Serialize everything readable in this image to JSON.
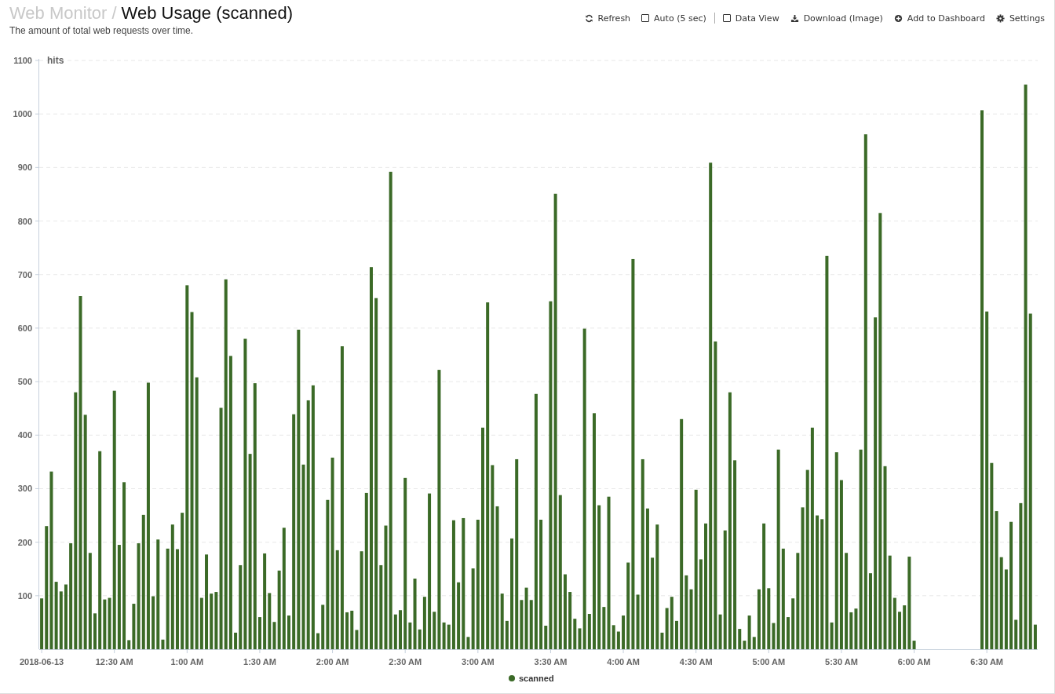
{
  "header": {
    "breadcrumb": "Web Monitor /",
    "title": "Web Usage (scanned)",
    "subtitle": "The amount of total web requests over time."
  },
  "toolbar": [
    {
      "kind": "refresh",
      "label": "Refresh"
    },
    {
      "kind": "checkbox",
      "label": "Auto (5 sec)",
      "checked": false
    },
    {
      "kind": "separator"
    },
    {
      "kind": "checkbox",
      "label": "Data View",
      "checked": false
    },
    {
      "kind": "download",
      "label": "Download (Image)"
    },
    {
      "kind": "add",
      "label": "Add to Dashboard"
    },
    {
      "kind": "settings",
      "label": "Settings"
    }
  ],
  "chart_data": {
    "type": "bar",
    "grid": true,
    "ylabel": "hits",
    "xlim": [
      -1,
      411
    ],
    "ylim": [
      0,
      1100
    ],
    "yticks": [
      100,
      200,
      300,
      400,
      500,
      600,
      700,
      800,
      900,
      1000,
      1100
    ],
    "xticks": [
      {
        "value": 0,
        "label": "2018-06-13"
      },
      {
        "value": 30,
        "label": "12:30 AM"
      },
      {
        "value": 60,
        "label": "1:00 AM"
      },
      {
        "value": 90,
        "label": "1:30 AM"
      },
      {
        "value": 120,
        "label": "2:00 AM"
      },
      {
        "value": 150,
        "label": "2:30 AM"
      },
      {
        "value": 180,
        "label": "3:00 AM"
      },
      {
        "value": 210,
        "label": "3:30 AM"
      },
      {
        "value": 240,
        "label": "4:00 AM"
      },
      {
        "value": 270,
        "label": "4:30 AM"
      },
      {
        "value": 300,
        "label": "5:00 AM"
      },
      {
        "value": 330,
        "label": "5:30 AM"
      },
      {
        "value": 360,
        "label": "6:00 AM"
      },
      {
        "value": 390,
        "label": "6:30 AM"
      }
    ],
    "x": [
      0,
      2,
      4,
      6,
      8,
      10,
      12,
      14,
      16,
      18,
      20,
      22,
      24,
      26,
      28,
      30,
      32,
      34,
      36,
      38,
      40,
      42,
      44,
      46,
      48,
      50,
      52,
      54,
      56,
      58,
      60,
      62,
      64,
      66,
      68,
      70,
      72,
      74,
      76,
      78,
      80,
      82,
      84,
      86,
      88,
      90,
      92,
      94,
      96,
      98,
      100,
      102,
      104,
      106,
      108,
      110,
      112,
      114,
      116,
      118,
      120,
      122,
      124,
      126,
      128,
      130,
      132,
      134,
      136,
      138,
      140,
      142,
      144,
      146,
      148,
      150,
      152,
      154,
      156,
      158,
      160,
      162,
      164,
      166,
      168,
      170,
      172,
      174,
      176,
      178,
      180,
      182,
      184,
      186,
      188,
      190,
      192,
      194,
      196,
      198,
      200,
      202,
      204,
      206,
      208,
      210,
      212,
      214,
      216,
      218,
      220,
      222,
      224,
      226,
      228,
      230,
      232,
      234,
      236,
      238,
      240,
      242,
      244,
      246,
      248,
      250,
      252,
      254,
      256,
      258,
      260,
      262,
      264,
      266,
      268,
      270,
      272,
      274,
      276,
      278,
      280,
      282,
      284,
      286,
      288,
      290,
      292,
      294,
      296,
      298,
      300,
      302,
      304,
      306,
      308,
      310,
      312,
      314,
      316,
      318,
      320,
      322,
      324,
      326,
      328,
      330,
      332,
      334,
      336,
      338,
      340,
      342,
      344,
      346,
      348,
      350,
      352,
      354,
      356,
      358,
      360,
      388,
      390,
      392,
      394,
      396,
      398,
      400,
      402,
      404,
      406,
      408,
      410
    ],
    "series": [
      {
        "name": "scanned",
        "color": "#3b6a27",
        "values": [
          95,
          230,
          332,
          126,
          108,
          121,
          198,
          480,
          660,
          438,
          180,
          67,
          370,
          93,
          96,
          483,
          195,
          312,
          17,
          85,
          198,
          251,
          498,
          99,
          205,
          18,
          188,
          233,
          187,
          255,
          680,
          630,
          508,
          96,
          177,
          104,
          107,
          451,
          691,
          548,
          31,
          157,
          580,
          365,
          497,
          60,
          179,
          105,
          51,
          147,
          227,
          63,
          439,
          597,
          345,
          465,
          493,
          30,
          83,
          279,
          358,
          185,
          566,
          69,
          72,
          36,
          183,
          292,
          714,
          656,
          157,
          231,
          892,
          65,
          73,
          320,
          50,
          132,
          37,
          98,
          291,
          70,
          522,
          50,
          46,
          241,
          125,
          245,
          23,
          151,
          242,
          414,
          648,
          344,
          267,
          104,
          53,
          207,
          355,
          92,
          115,
          92,
          477,
          242,
          44,
          650,
          851,
          288,
          140,
          107,
          57,
          39,
          599,
          66,
          441,
          269,
          79,
          285,
          45,
          33,
          63,
          162,
          729,
          102,
          355,
          263,
          171,
          233,
          31,
          77,
          98,
          53,
          430,
          138,
          112,
          298,
          168,
          235,
          909,
          575,
          65,
          222,
          480,
          353,
          38,
          16,
          63,
          23,
          112,
          235,
          114,
          49,
          373,
          188,
          60,
          95,
          180,
          265,
          335,
          414,
          250,
          243,
          735,
          50,
          368,
          316,
          180,
          69,
          76,
          373,
          962,
          142,
          620,
          815,
          342,
          175,
          96,
          70,
          82,
          173,
          16,
          1007,
          631,
          348,
          258,
          172,
          149,
          238,
          55,
          273,
          1055,
          627,
          46
        ]
      }
    ]
  }
}
